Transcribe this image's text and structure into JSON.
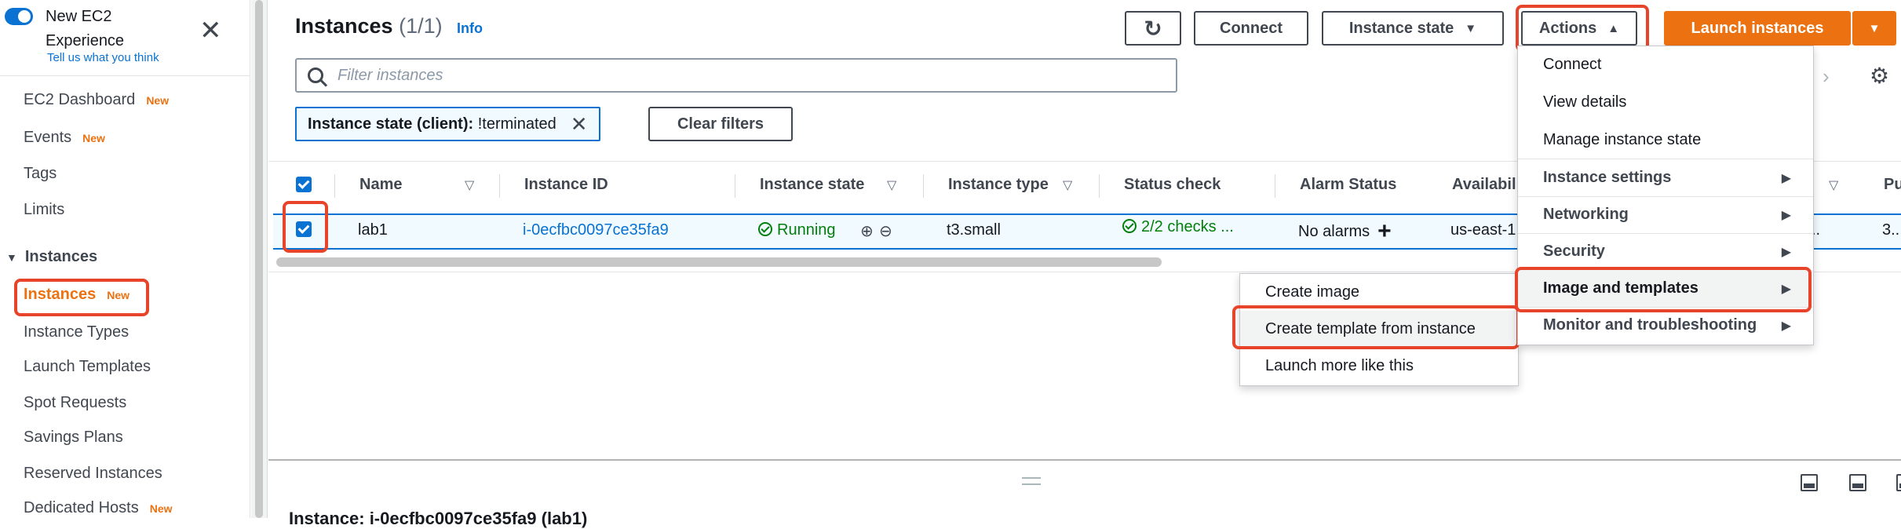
{
  "sidebar": {
    "experience_title": "New EC2 Experience",
    "feedback_link": "Tell us what you think",
    "new_badge": "New",
    "items": [
      {
        "label": "EC2 Dashboard",
        "badge": "New"
      },
      {
        "label": "Events",
        "badge": "New"
      },
      {
        "label": "Tags"
      },
      {
        "label": "Limits"
      }
    ],
    "section_title": "Instances",
    "section_items": [
      {
        "label": "Instances",
        "badge": "New",
        "active": true
      },
      {
        "label": "Instance Types"
      },
      {
        "label": "Launch Templates"
      },
      {
        "label": "Spot Requests"
      },
      {
        "label": "Savings Plans"
      },
      {
        "label": "Reserved Instances"
      },
      {
        "label": "Dedicated Hosts",
        "badge": "New"
      }
    ]
  },
  "header": {
    "title": "Instances",
    "count": "(1/1)",
    "info": "Info",
    "connect_label": "Connect",
    "instance_state_label": "Instance state",
    "actions_label": "Actions",
    "launch_label": "Launch instances"
  },
  "search": {
    "placeholder": "Filter instances"
  },
  "filter": {
    "key": "Instance state (client):",
    "value": "!terminated",
    "clear_label": "Clear filters"
  },
  "table": {
    "columns": [
      "Name",
      "Instance ID",
      "Instance state",
      "Instance type",
      "Status check",
      "Alarm Status",
      "Availabil",
      "Pu"
    ],
    "rows": [
      {
        "name": "lab1",
        "instance_id": "i-0ecfbc0097ce35fa9",
        "state": "Running",
        "type": "t3.small",
        "status_check": "2/2 checks ...",
        "alarm": "No alarms",
        "availability": "us-east-1",
        "az_overflow": "..",
        "public": "3.."
      }
    ]
  },
  "details": {
    "title": "Instance: i-0ecfbc0097ce35fa9 (lab1)"
  },
  "actions_menu": {
    "items": [
      {
        "label": "Connect",
        "submenu": false
      },
      {
        "label": "View details",
        "submenu": false
      },
      {
        "label": "Manage instance state",
        "submenu": false
      },
      {
        "label": "Instance settings",
        "submenu": true
      },
      {
        "label": "Networking",
        "submenu": true
      },
      {
        "label": "Security",
        "submenu": true
      },
      {
        "label": "Image and templates",
        "submenu": true,
        "highlighted": true
      },
      {
        "label": "Monitor and troubleshooting",
        "submenu": true
      }
    ]
  },
  "image_submenu": {
    "items": [
      {
        "label": "Create image"
      },
      {
        "label": "Create template from instance",
        "highlighted": true
      },
      {
        "label": "Launch more like this"
      }
    ]
  },
  "colors": {
    "accent": "#0972d3",
    "brand_orange": "#ec7211",
    "success": "#037f0c",
    "highlight_box": "#e8442b"
  }
}
